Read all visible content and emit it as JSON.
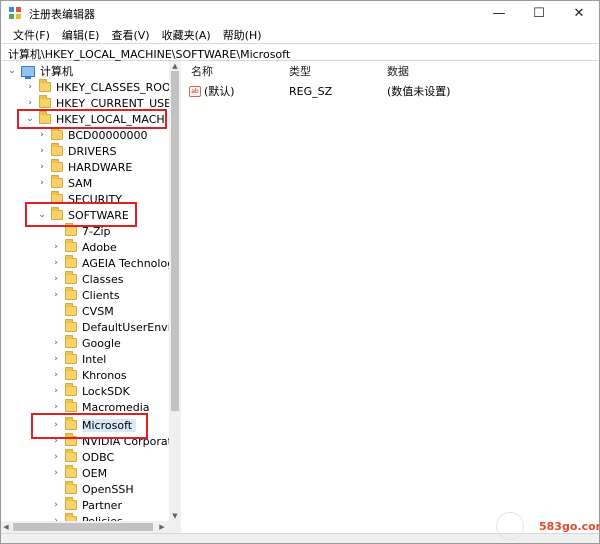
{
  "window": {
    "title": "注册表编辑器",
    "controls": {
      "minimize": "—",
      "maximize": "☐",
      "close": "✕"
    }
  },
  "menu": [
    "文件(F)",
    "编辑(E)",
    "查看(V)",
    "收藏夹(A)",
    "帮助(H)"
  ],
  "address": "计算机\\HKEY_LOCAL_MACHINE\\SOFTWARE\\Microsoft",
  "tree": {
    "root": "计算机",
    "hives": {
      "classes_root": "HKEY_CLASSES_ROOT",
      "current_user": "HKEY_CURRENT_USER",
      "local_machine": "HKEY_LOCAL_MACHINE"
    },
    "hklm_children": [
      "BCD00000000",
      "DRIVERS",
      "HARDWARE",
      "SAM",
      "SECURITY",
      "SOFTWARE"
    ],
    "software_children": [
      "7-Zip",
      "Adobe",
      "AGEIA Technologies",
      "Classes",
      "Clients",
      "CVSM",
      "DefaultUserEnvironment",
      "Google",
      "Intel",
      "Khronos",
      "LockSDK",
      "Macromedia",
      "Microsoft",
      "NVIDIA Corporation",
      "ODBC",
      "OEM",
      "OpenSSH",
      "Partner",
      "Policies"
    ],
    "selected": "Microsoft"
  },
  "values": {
    "columns": {
      "name": "名称",
      "type": "类型",
      "data": "数据"
    },
    "rows": [
      {
        "icon": "string-value-icon",
        "icon_text": "ab",
        "name": "(默认)",
        "type": "REG_SZ",
        "data": "(数值未设置)"
      }
    ]
  },
  "watermark": "583go.com",
  "colors": {
    "highlight": "#e02020",
    "folder": "#f7d26a",
    "selection": "#d9e8f7"
  }
}
